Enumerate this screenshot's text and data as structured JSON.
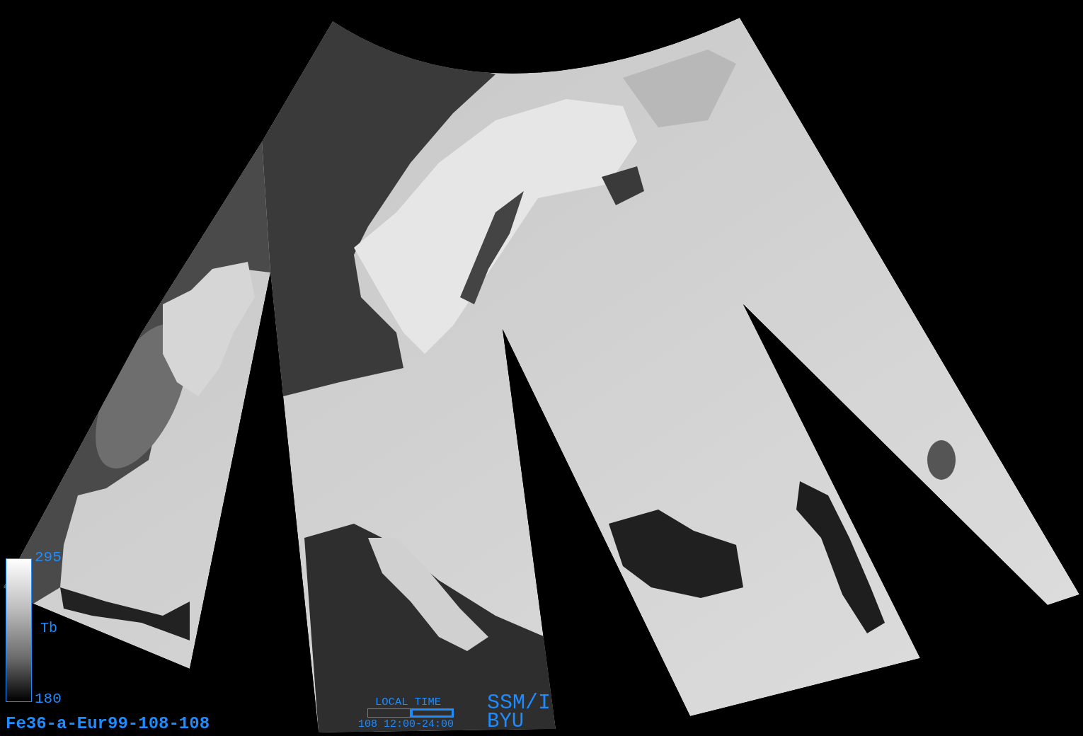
{
  "colorbar": {
    "max_label": "295",
    "quantity_label": "Tb",
    "min_label": "180"
  },
  "image_id": "Fe36-a-Eur99-108-108",
  "local_time": {
    "title": "LOCAL TIME",
    "segments": [
      {
        "selected": false
      },
      {
        "selected": true
      }
    ],
    "caption": "108 12:00-24:00"
  },
  "sensor": {
    "name": "SSM/I",
    "institution": "BYU"
  }
}
